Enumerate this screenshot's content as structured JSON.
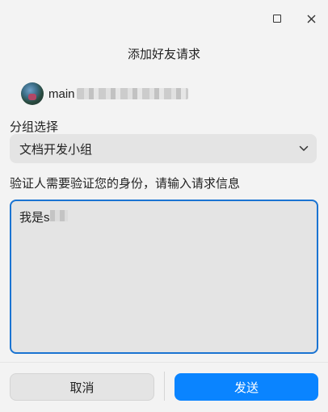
{
  "window": {
    "title": "添加好友请求",
    "controls": [
      "maximize-icon",
      "close-icon"
    ]
  },
  "user": {
    "name_visible": "main",
    "avatar": "avatar-image"
  },
  "group": {
    "label": "分组选择",
    "selected": "文档开发小组",
    "icon": "chevron-down-icon"
  },
  "verify": {
    "label": "验证人需要验证您的身份，请输入请求信息",
    "value": "我是s"
  },
  "buttons": {
    "cancel": "取消",
    "send": "发送"
  },
  "colors": {
    "accent": "#0a84ff",
    "focus_border": "#1a74d2",
    "background": "#f3f3f3"
  }
}
